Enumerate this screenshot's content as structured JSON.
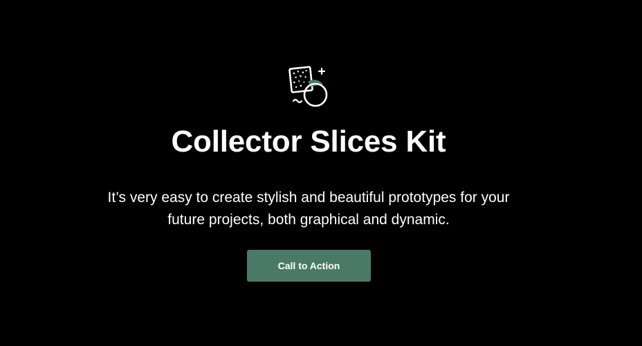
{
  "logo": {
    "icon": "collector-slices-icon",
    "colors": {
      "outline": "#ffffff",
      "accent": "#4a7a67"
    }
  },
  "hero": {
    "title": "Collector Slices Kit",
    "subtitle_line1": "It’s very easy to create stylish and beautiful prototypes for your",
    "subtitle_line2": "future projects, both graphical and dynamic."
  },
  "cta": {
    "label": "Call to Action",
    "background": "#4a7a67"
  },
  "theme": {
    "background": "#000000",
    "text": "#ffffff"
  }
}
